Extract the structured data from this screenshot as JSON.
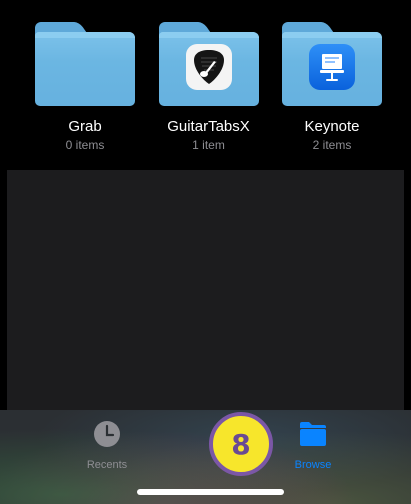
{
  "folders": [
    {
      "name": "Grab",
      "count": "0 items",
      "icon": "folder-icon"
    },
    {
      "name": "GuitarTabsX",
      "count": "1 item",
      "icon": "guitar-pick-icon"
    },
    {
      "name": "Keynote",
      "count": "2 items",
      "icon": "keynote-icon"
    }
  ],
  "tab_bar": {
    "recents": {
      "label": "Recents",
      "icon": "clock-icon",
      "color": "#8e8e93"
    },
    "browse": {
      "label": "Browse",
      "icon": "folder-icon",
      "color": "#0a84ff",
      "selected": true
    }
  },
  "step_badge": {
    "value": "8",
    "fill": "#f7e62b",
    "border": "#7b57a6"
  },
  "colors": {
    "folder": "#6bb6e2",
    "background": "#000000",
    "accent": "#0a84ff"
  }
}
